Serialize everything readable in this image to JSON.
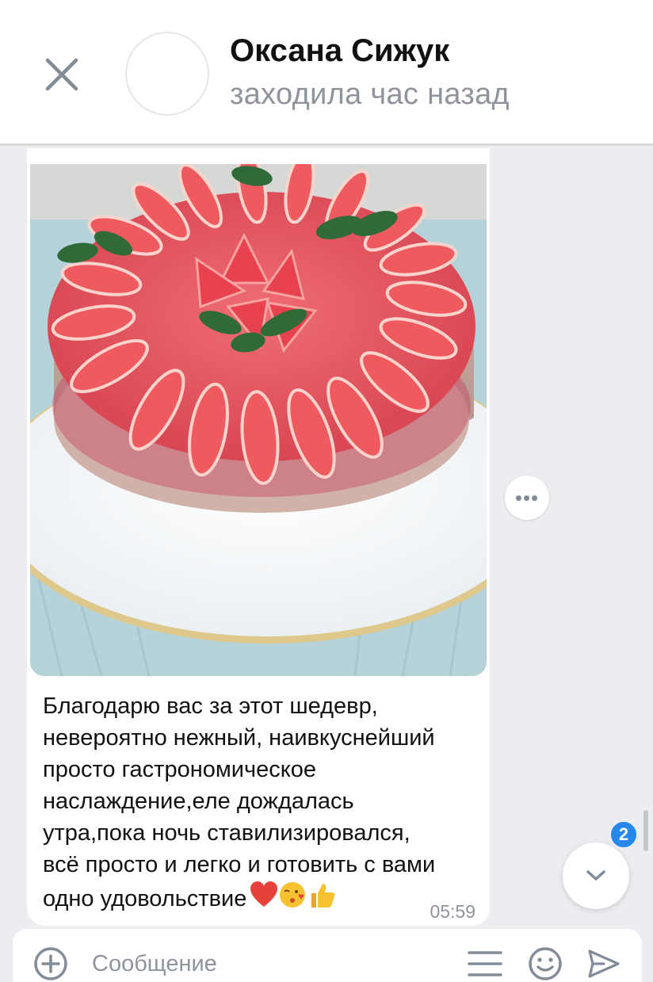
{
  "header": {
    "contact_name": "Оксана Сижук",
    "contact_status": "заходила час назад"
  },
  "message": {
    "text_lines": [
      "Благодарю вас за этот шедевр,",
      "невероятно нежный, наивкуснейший",
      "просто гастрономическое",
      "наслаждение,еле дождалась",
      "утра,пока ночь ставилизировался,",
      "всё просто и легко и готовить с вами",
      "одно удовольствие"
    ],
    "emojis": [
      "heart-icon",
      "kiss-face-icon",
      "thumbs-up-icon"
    ],
    "time": "05:59",
    "photo_icon": "strawberry-cake-photo"
  },
  "more_button": {
    "label": "•••"
  },
  "scroll_down": {
    "unread_count": "2"
  },
  "composer": {
    "placeholder": "Сообщение"
  },
  "colors": {
    "accent": "#2688eb",
    "background": "#ebedf0",
    "secondary_text": "#8f949c",
    "icon": "#818c99"
  }
}
